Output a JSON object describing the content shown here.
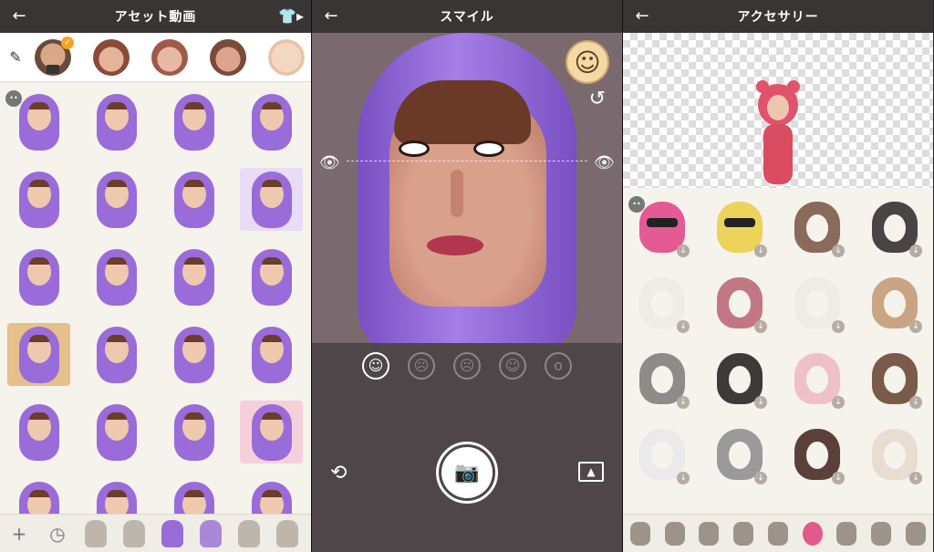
{
  "screen1": {
    "title": "アセット動画",
    "back_icon": "arrow-left-icon",
    "shirt_icon": "shirt-icon",
    "face_row": [
      "face-avatar-1",
      "face-avatar-2",
      "face-avatar-3",
      "face-avatar-4",
      "face-avatar-5"
    ],
    "stickers": [
      {
        "name": "cheer",
        "bg": ""
      },
      {
        "name": "peace",
        "bg": ""
      },
      {
        "name": "laugh-peace",
        "bg": ""
      },
      {
        "name": "giggle",
        "bg": ""
      },
      {
        "name": "crouch",
        "bg": ""
      },
      {
        "name": "lying",
        "bg": ""
      },
      {
        "name": "jump",
        "bg": ""
      },
      {
        "name": "sparkle-jump",
        "bg": "#e8dcf6"
      },
      {
        "name": "swing",
        "bg": ""
      },
      {
        "name": "dance",
        "bg": ""
      },
      {
        "name": "hang",
        "bg": ""
      },
      {
        "name": "trophy",
        "bg": ""
      },
      {
        "name": "champagne",
        "bg": "#e6c08a"
      },
      {
        "name": "cheerleader",
        "bg": ""
      },
      {
        "name": "sparkle",
        "bg": ""
      },
      {
        "name": "think",
        "bg": ""
      },
      {
        "name": "foam-finger",
        "bg": ""
      },
      {
        "name": "thumbs-up",
        "bg": ""
      },
      {
        "name": "wave",
        "bg": ""
      },
      {
        "name": "confetti",
        "bg": "#f6cfdc"
      },
      {
        "name": "ok",
        "bg": ""
      },
      {
        "name": "ring-toss",
        "bg": ""
      },
      {
        "name": "sitting",
        "bg": ""
      },
      {
        "name": "surprise",
        "bg": ""
      }
    ],
    "bottom_icons": [
      "plus-icon",
      "clock-icon",
      "mummy-icon",
      "balloon-icon",
      "hoodie-icon",
      "group-icon",
      "desk-icon",
      "hooded-grey-icon"
    ]
  },
  "screen2": {
    "title": "スマイル",
    "expressions": [
      "smile-icon",
      "angry-icon",
      "sad-icon",
      "grin-icon",
      "surprised-icon"
    ]
  },
  "screen3": {
    "title": "アクセサリー",
    "accessories": [
      {
        "name": "pink-ranger-helmet",
        "color": "#e35a94",
        "helmet": true
      },
      {
        "name": "yellow-ranger-helmet",
        "color": "#ecd35a",
        "helmet": true
      },
      {
        "name": "brown-bear-hood",
        "color": "#8a6a5a",
        "helmet": false
      },
      {
        "name": "black-bear-hood",
        "color": "#4a4444",
        "helmet": false
      },
      {
        "name": "panda-hood",
        "color": "#efebe6",
        "helmet": false
      },
      {
        "name": "pink-bear-hood",
        "color": "#c27785",
        "helmet": false
      },
      {
        "name": "white-bear-hood",
        "color": "#efebe6",
        "helmet": false
      },
      {
        "name": "fox-hood",
        "color": "#c9a585",
        "helmet": false
      },
      {
        "name": "grey-cat-hood",
        "color": "#8f8b88",
        "helmet": false
      },
      {
        "name": "black-cat-hood",
        "color": "#3e3a3a",
        "helmet": false
      },
      {
        "name": "bunny-hood",
        "color": "#f0c0c8",
        "helmet": false
      },
      {
        "name": "reindeer-hood",
        "color": "#7a5a48",
        "helmet": false
      },
      {
        "name": "cow-hood",
        "color": "#eaeaea",
        "helmet": false
      },
      {
        "name": "zebra-hood",
        "color": "#9a9a9a",
        "helmet": false
      },
      {
        "name": "bull-hood",
        "color": "#5a4038",
        "helmet": false
      },
      {
        "name": "ram-hood",
        "color": "#e8ddd0",
        "helmet": false
      }
    ],
    "categories": [
      "hair-1",
      "hair-2",
      "hair-3",
      "hair-4",
      "cap",
      "helmet",
      "dress",
      "suit",
      "gown"
    ]
  }
}
